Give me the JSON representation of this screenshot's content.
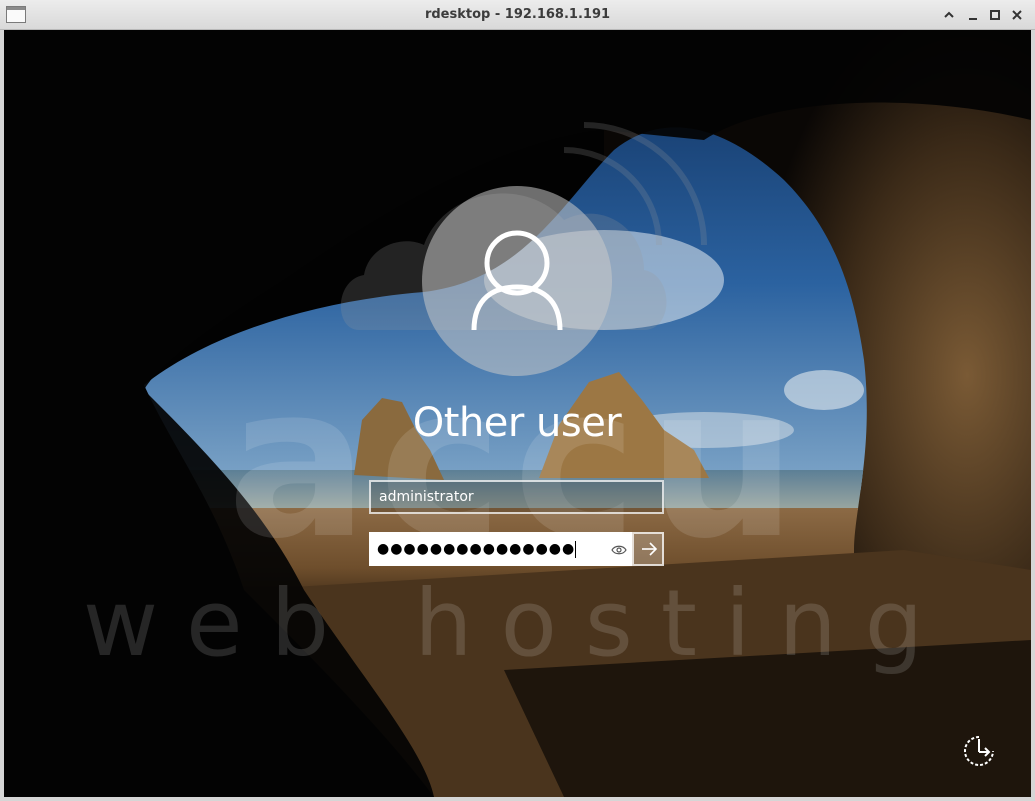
{
  "window": {
    "title": "rdesktop - 192.168.1.191"
  },
  "watermark": {
    "brand": "accu",
    "tagline": "web hosting"
  },
  "login": {
    "user_display_name": "Other user",
    "username_value": "administrator",
    "password_masked": "●●●●●●●●●●●●●●●",
    "icons": {
      "avatar": "user-silhouette-icon",
      "reveal": "eye-icon",
      "submit": "arrow-right-icon",
      "ease_of_access": "ease-of-access-icon"
    }
  },
  "colors": {
    "text": "#ffffff",
    "field_border": "#ffffff",
    "titlebar": "#e0e0e0"
  }
}
